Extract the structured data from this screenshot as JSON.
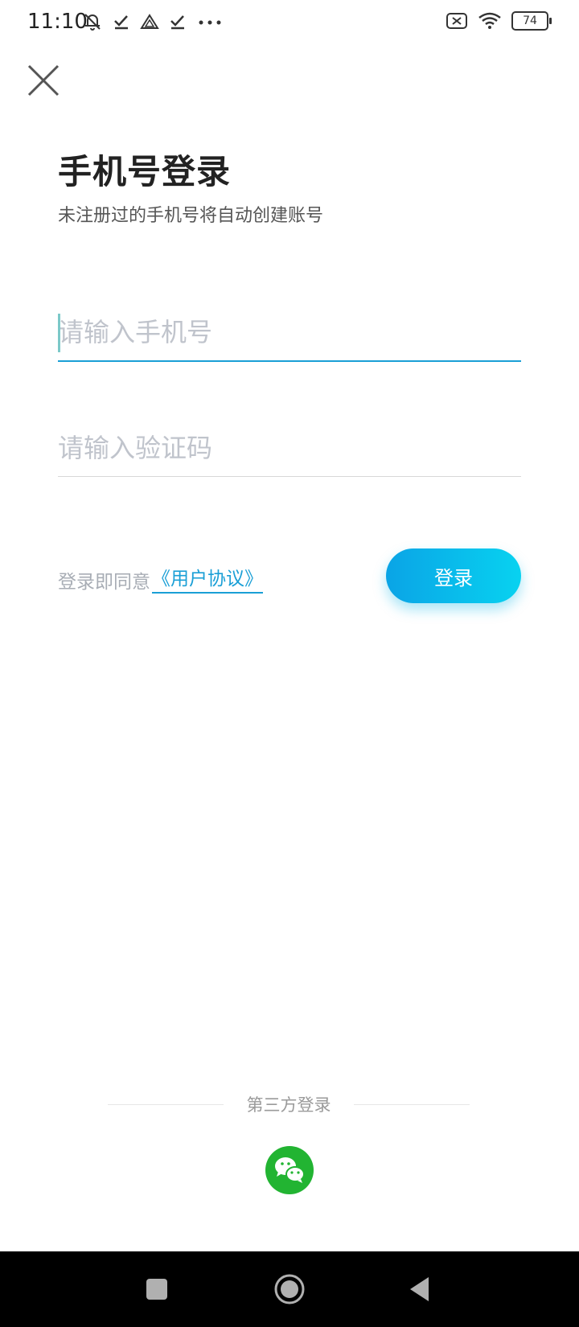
{
  "status_bar": {
    "time": "11:10",
    "battery": "74",
    "left_icons": [
      "mute-bell-icon",
      "check-icon",
      "drive-icon",
      "check-icon",
      "more-icon"
    ],
    "right_icons": [
      "sim-error-icon",
      "wifi-icon",
      "battery-icon"
    ]
  },
  "header": {
    "close_icon": "close-icon"
  },
  "login": {
    "title": "手机号登录",
    "subtitle": "未注册过的手机号将自动创建账号",
    "phone_placeholder": "请输入手机号",
    "code_placeholder": "请输入验证码",
    "agreement_prefix": "登录即同意",
    "agreement_link": "《用户协议》",
    "login_button": "登录"
  },
  "third_party": {
    "label": "第三方登录",
    "wechat_icon": "wechat-icon"
  },
  "nav_bar": {
    "buttons": [
      "recents-icon",
      "home-icon",
      "back-icon"
    ]
  },
  "colors": {
    "accent": "#1a9fd6",
    "button_gradient_start": "#0aa4e6",
    "button_gradient_end": "#08d2f0",
    "wechat": "#22b432"
  }
}
